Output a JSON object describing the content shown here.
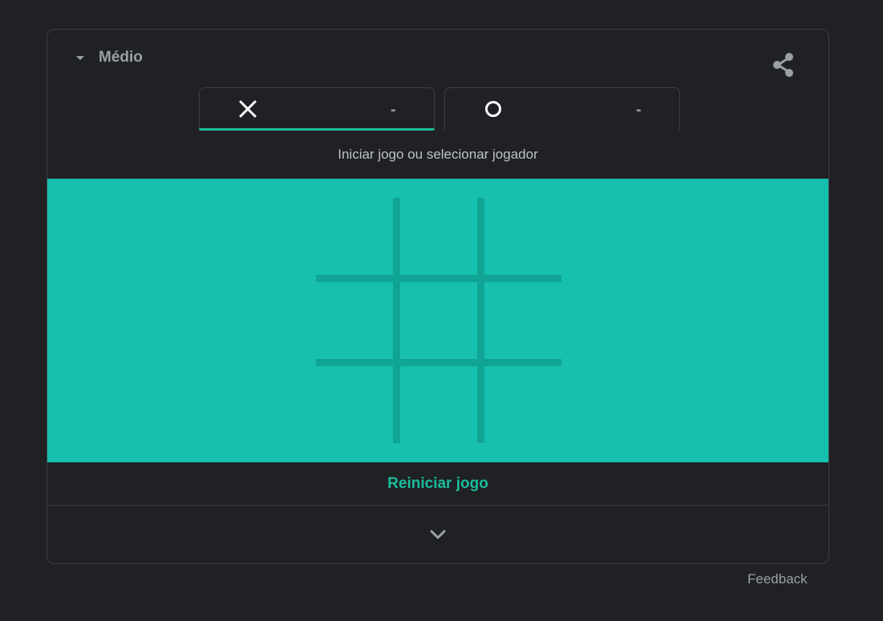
{
  "header": {
    "difficulty_label": "Médio",
    "icons": {
      "dropdown": "caret-down-icon",
      "share": "share-icon"
    }
  },
  "players": [
    {
      "symbol": "X",
      "icon": "x-mark-icon",
      "score": "-",
      "active": true
    },
    {
      "symbol": "O",
      "icon": "o-mark-icon",
      "score": "-",
      "active": false
    }
  ],
  "status_text": "Iniciar jogo ou selecionar jogador",
  "board": {
    "cells": [
      "",
      "",
      "",
      "",
      "",
      "",
      "",
      "",
      ""
    ]
  },
  "restart_label": "Reiniciar jogo",
  "expand_icon": "chevron-down-icon",
  "feedback_label": "Feedback",
  "colors": {
    "background": "#202124",
    "board": "#17bfae",
    "grid_lines": "#0fa493",
    "accent": "#1abc9c",
    "muted_text": "#9aa0a6"
  }
}
